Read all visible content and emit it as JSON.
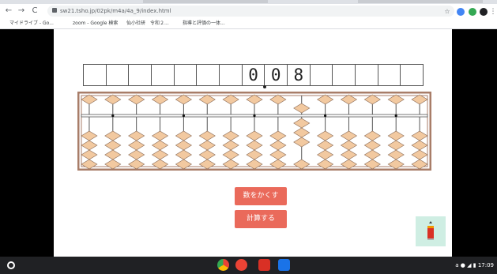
{
  "browser": {
    "url": "sw21.tsho.jp/02pk/m4a/4a_9/index.html",
    "nav": {
      "back": "←",
      "forward": "→",
      "reload": "C"
    }
  },
  "bookmarks": [
    {
      "label": "マイドライブ - Go...",
      "icon_color": "#fbbc04"
    },
    {
      "label": "zoom - Google 検索",
      "icon_color": "#4285f4"
    },
    {
      "label": "仙小社研",
      "icon_color": "#202124"
    },
    {
      "label": "令和２...",
      "icon_color": ""
    },
    {
      "label": "指導と評価の一体...",
      "icon_color": "#188038"
    }
  ],
  "app": {
    "display_digits": [
      "",
      "",
      "",
      "",
      "",
      "",
      "",
      "0",
      "0",
      "8",
      "",
      "",
      "",
      "",
      ""
    ],
    "abacus": {
      "rods": 15,
      "heaven_set": [
        false,
        false,
        false,
        false,
        false,
        false,
        false,
        false,
        false,
        true,
        false,
        false,
        false,
        false,
        false
      ],
      "earth_up": [
        0,
        0,
        0,
        0,
        0,
        0,
        0,
        0,
        0,
        3,
        0,
        0,
        0,
        0,
        0
      ],
      "unit_dot_rods": [
        1,
        4,
        7,
        10,
        13
      ],
      "bead_color": "#f2c9a0",
      "frame_color": "#a87d68"
    },
    "buttons": {
      "hide_number": "数をかくす",
      "calculate": "計算する"
    },
    "accent": "#ea6a5b"
  },
  "shelf": {
    "apps": [
      {
        "name": "chrome",
        "color": "#4285f4"
      },
      {
        "name": "screencast",
        "color": "#ea4335"
      },
      {
        "name": "app-red",
        "color": "#d93025"
      },
      {
        "name": "app-blue",
        "color": "#1a73e8"
      }
    ],
    "time": "17:09"
  }
}
